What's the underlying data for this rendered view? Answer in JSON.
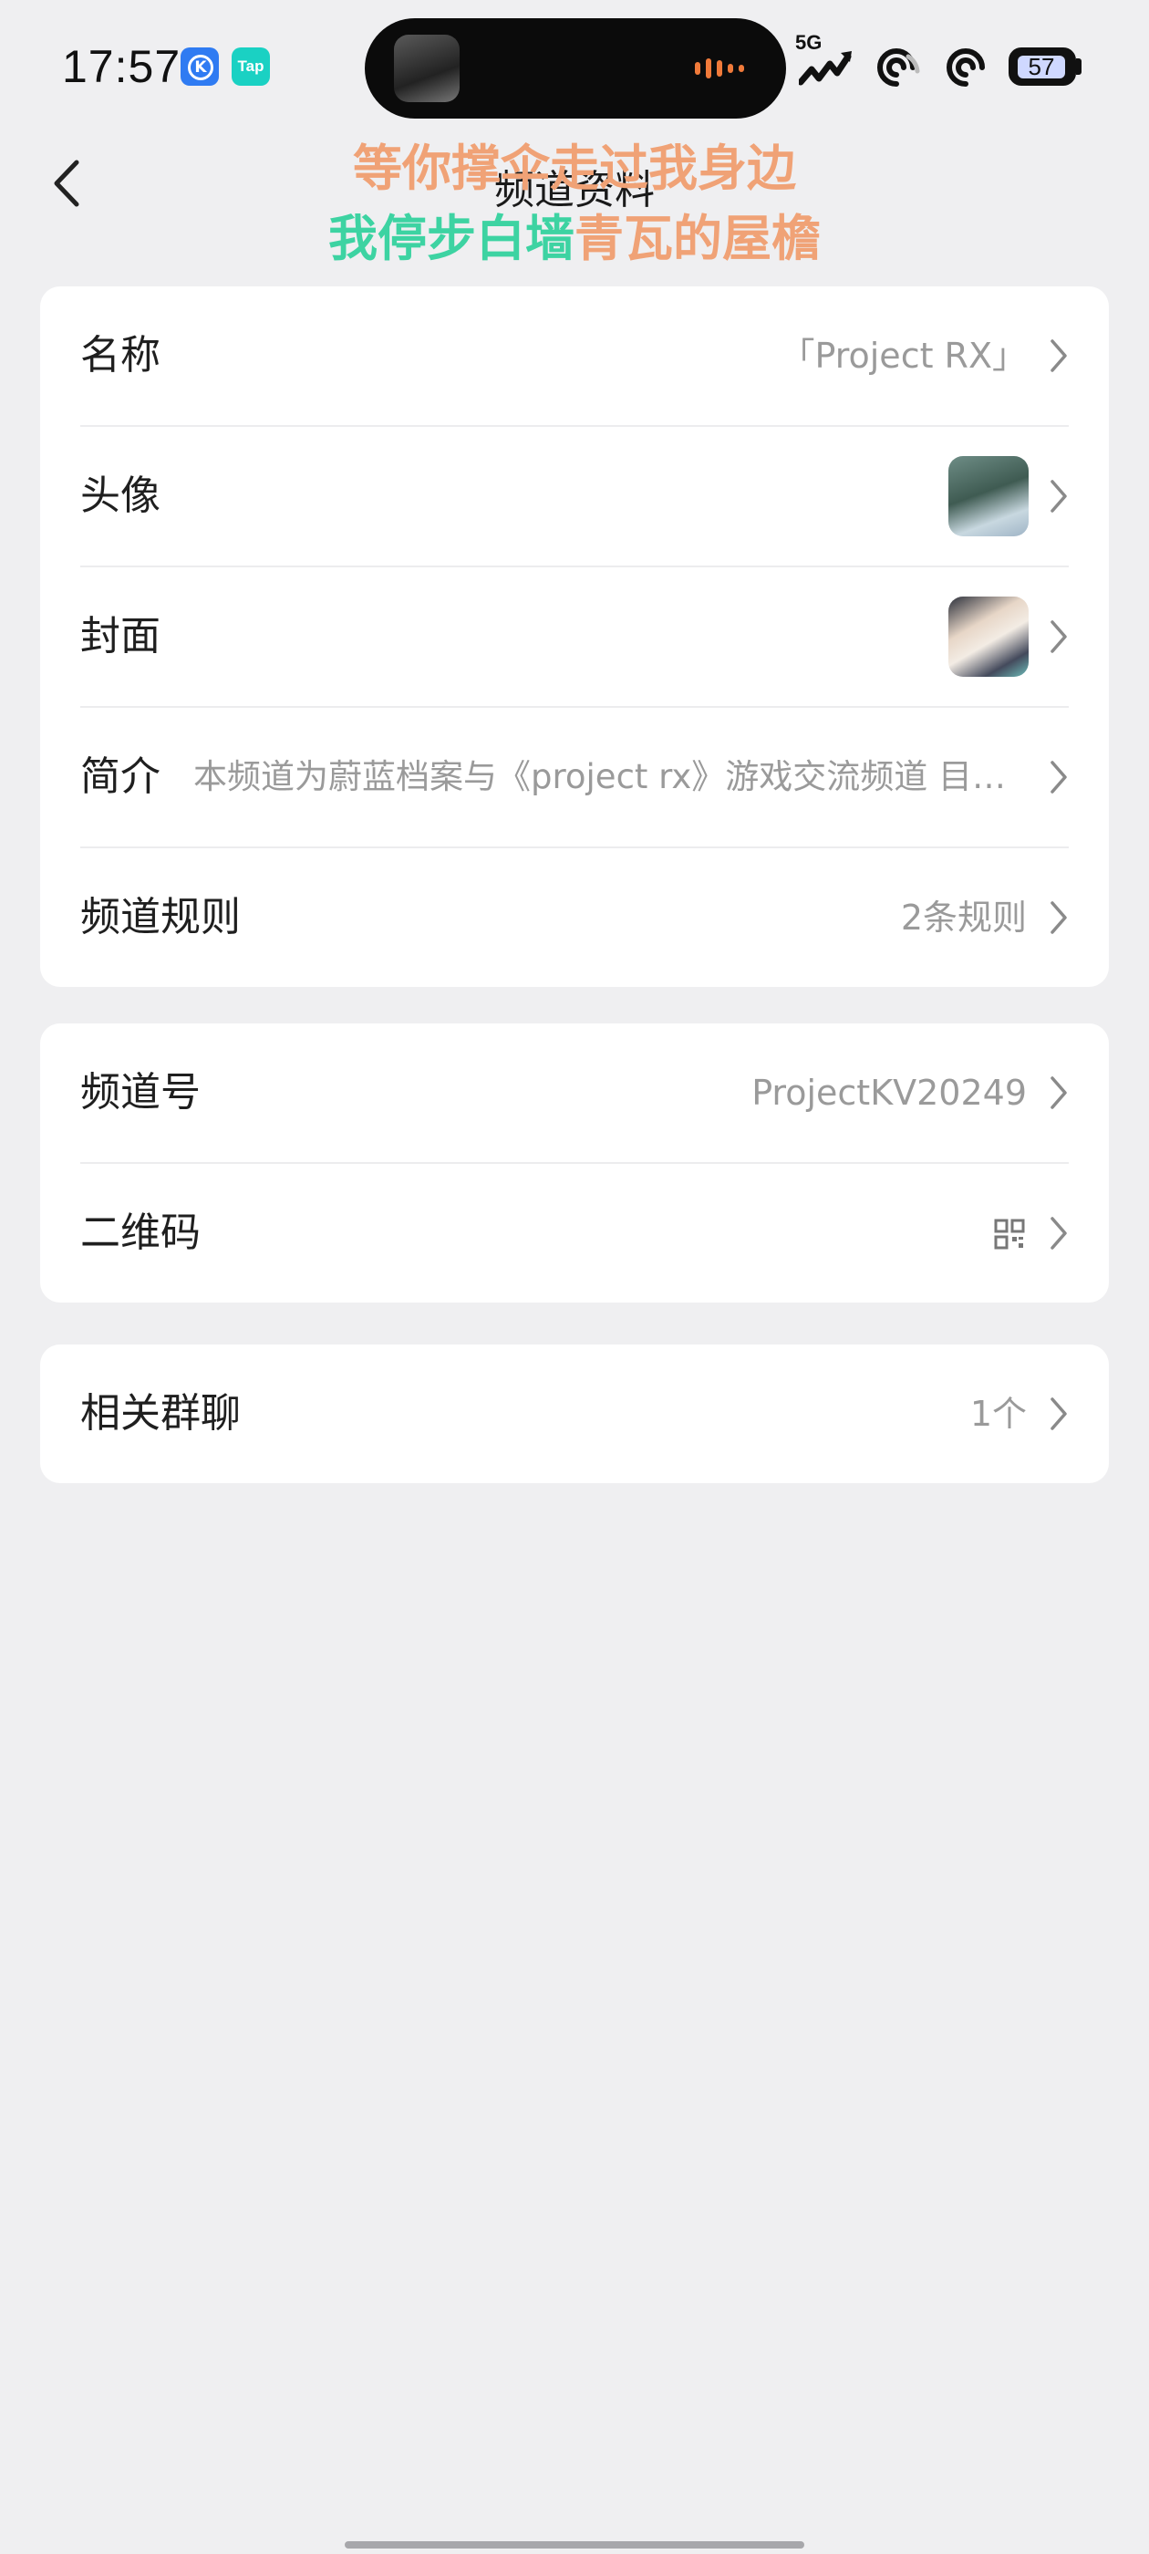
{
  "status_bar": {
    "time": "17:57",
    "app_badge_k": "K",
    "app_badge_tap": "Tap",
    "network": "5G",
    "battery": "57"
  },
  "header": {
    "title": "频道资料",
    "lyric_line_1": "等你撑伞走过我身边",
    "lyric_line_2_a": "我停步白墙",
    "lyric_line_2_b": "青瓦的屋檐"
  },
  "section_1": {
    "name_label": "名称",
    "name_value": "「Project RX」",
    "avatar_label": "头像",
    "cover_label": "封面",
    "intro_label": "简介",
    "intro_value": "本频道为蔚蓝档案与《project rx》游戏交流频道 目…",
    "rules_label": "频道规则",
    "rules_value": "2条规则"
  },
  "section_2": {
    "channel_id_label": "频道号",
    "channel_id_value": "ProjectKV20249",
    "qrcode_label": "二维码"
  },
  "section_3": {
    "group_chat_label": "相关群聊",
    "group_chat_value": "1个"
  },
  "colors": {
    "background": "#efeff1",
    "card": "#ffffff",
    "secondary_text": "#9a9a9a",
    "lyric_orange": "#f0a276",
    "lyric_green": "#3dd3a2"
  }
}
